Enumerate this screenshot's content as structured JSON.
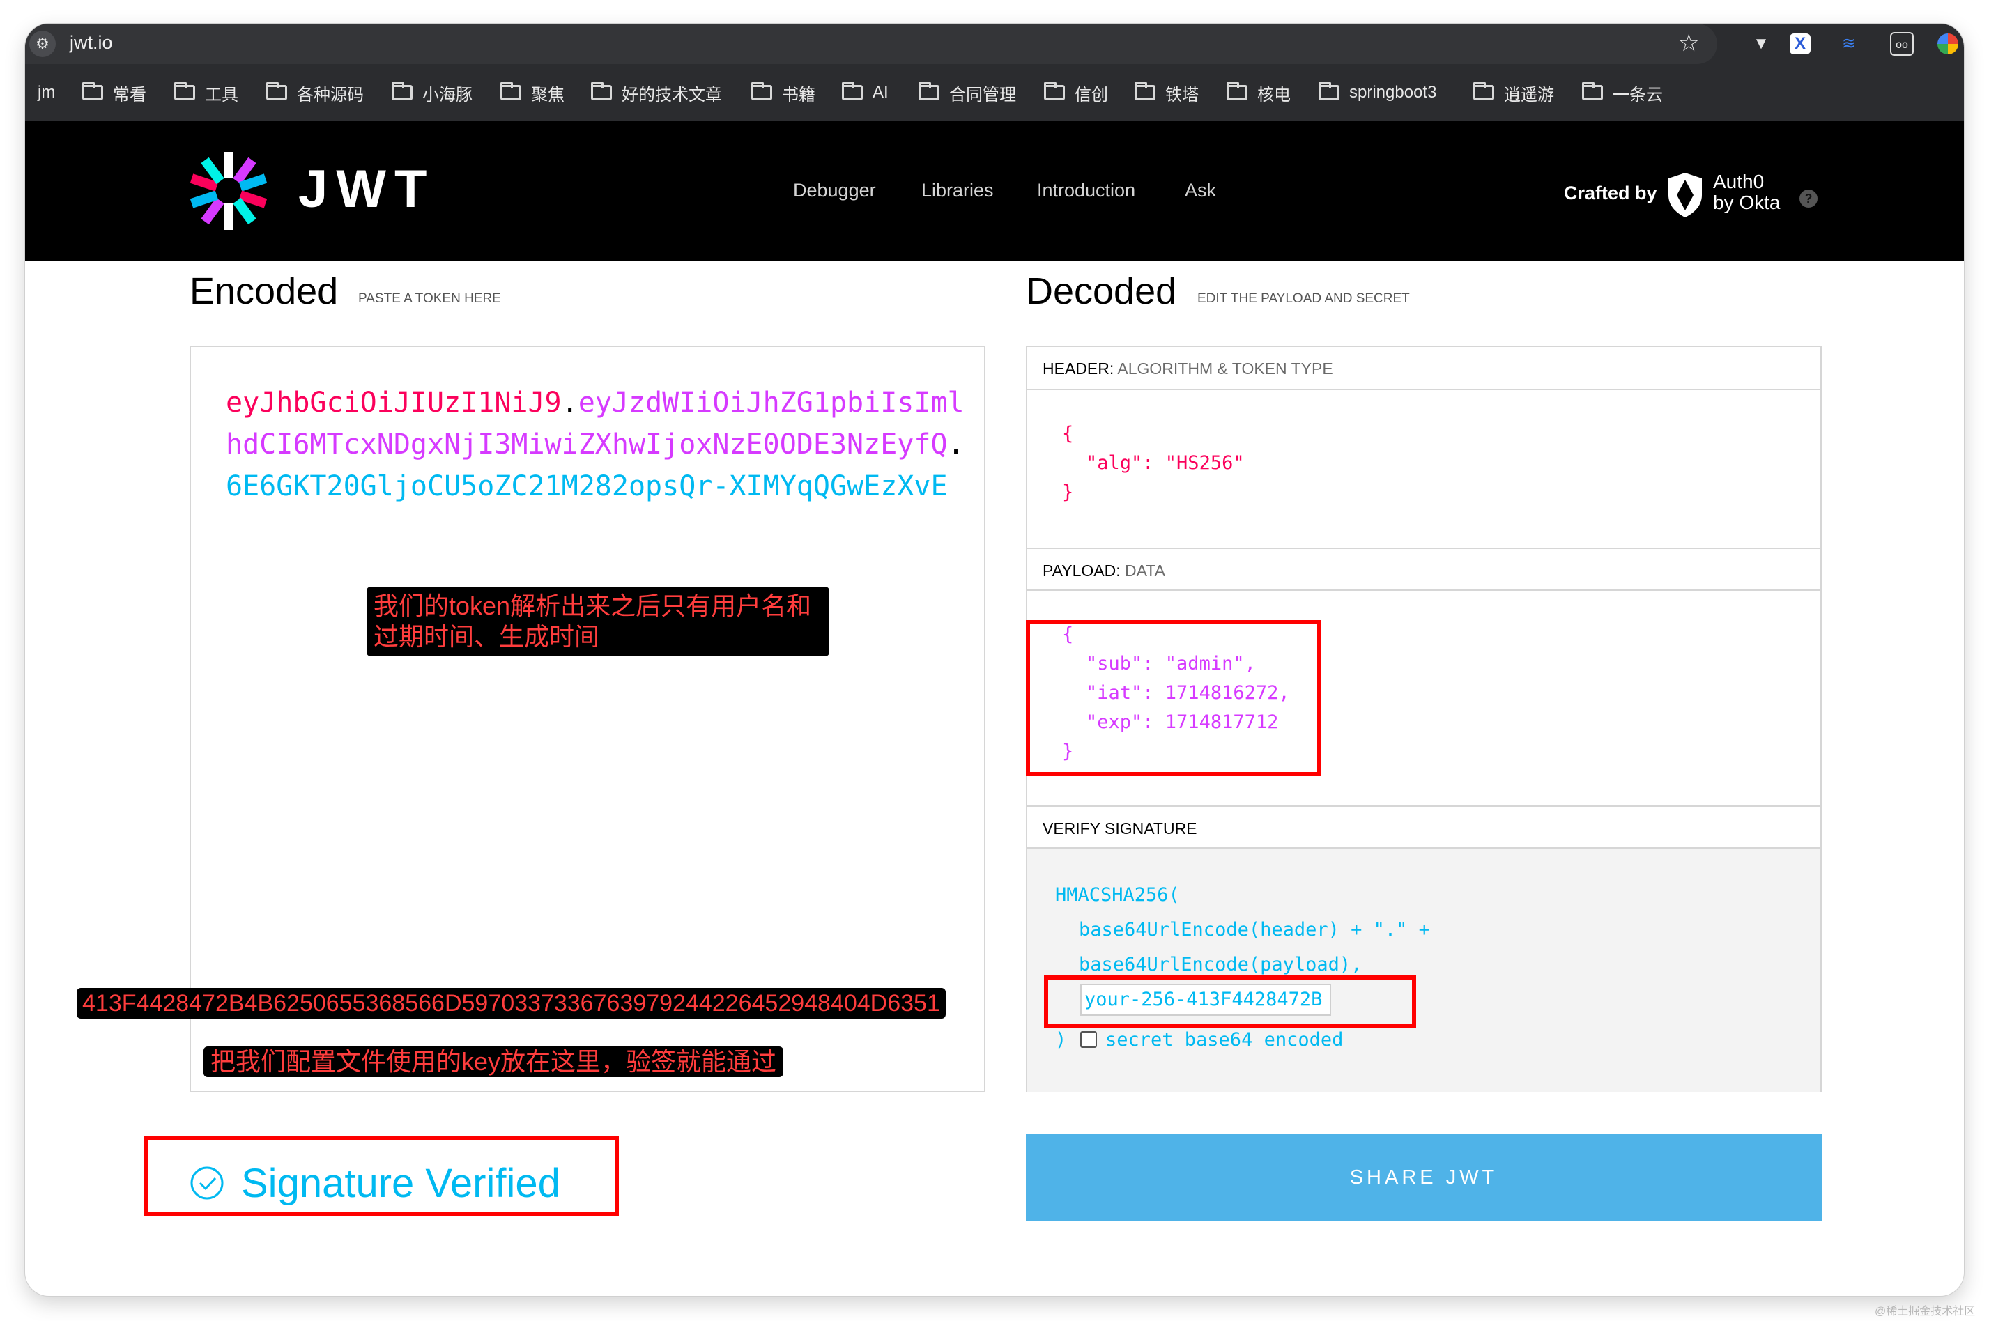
{
  "browser": {
    "url": "jwt.io",
    "bookmarks": [
      "jm",
      "常看",
      "工具",
      "各种源码",
      "小海豚",
      "聚焦",
      "好的技术文章",
      "书籍",
      "AI",
      "合同管理",
      "信创",
      "铁塔",
      "核电",
      "springboot3",
      "逍遥游",
      "一条云"
    ]
  },
  "nav": {
    "logo_text": "JWT",
    "links": [
      "Debugger",
      "Libraries",
      "Introduction",
      "Ask"
    ],
    "crafted_by": "Crafted by",
    "partner_line1": "Auth0",
    "partner_line2": "by Okta",
    "help": "?"
  },
  "encoded": {
    "title": "Encoded",
    "subtitle": "PASTE A TOKEN HERE",
    "header_part": "eyJhbGciOiJIUzI1NiJ9",
    "payload_part": "eyJzdWIiOiJhZG1pbiIsImlhdCI6MTcxNDgxNjI3MiwiZXhwIjoxNzE0ODE3NzEyfQ",
    "signature_part": "6E6GKT20GljoCU5oZC21M282opsQr-XIMYqQGwEzXvE",
    "dot": "."
  },
  "decoded": {
    "title": "Decoded",
    "subtitle": "EDIT THE PAYLOAD AND SECRET",
    "header_label": "HEADER:",
    "header_label_desc": "ALGORITHM & TOKEN TYPE",
    "header_json": {
      "open": "{",
      "alg_key": "\"alg\"",
      "alg_value": "\"HS256\"",
      "close": "}"
    },
    "payload_label": "PAYLOAD:",
    "payload_label_desc": "DATA",
    "payload_json": {
      "open": "{",
      "sub_key": "\"sub\"",
      "sub_value": "\"admin\",",
      "iat_key": "\"iat\"",
      "iat_value": "1714816272,",
      "exp_key": "\"exp\"",
      "exp_value": "1714817712",
      "close": "}"
    },
    "signature_label": "VERIFY SIGNATURE",
    "signature_lines": {
      "fn": "HMACSHA256(",
      "line1": "base64UrlEncode(header) + \".\" +",
      "line2": "base64UrlEncode(payload),",
      "close": ")",
      "checkbox_label": "secret base64 encoded"
    },
    "secret_value": "your-256-413F4428472B"
  },
  "annotations": {
    "token_note": "我们的token解析出来之后只有用户名和\n过期时间、生成时间",
    "key_value": "413F4428472B4B6250655368566D5970337336763979244226452948404D6351",
    "key_note": "把我们配置文件使用的key放在这里，验签就能通过"
  },
  "status": {
    "verified": "Signature Verified"
  },
  "share_button": "SHARE JWT",
  "watermark": "@稀土掘金技术社区",
  "colors": {
    "header_red": "#fb015b",
    "payload_purple": "#d63aff",
    "signature_cyan": "#00b9f1",
    "share_blue": "#4fb3e8",
    "annotation_red": "#ff0000"
  }
}
